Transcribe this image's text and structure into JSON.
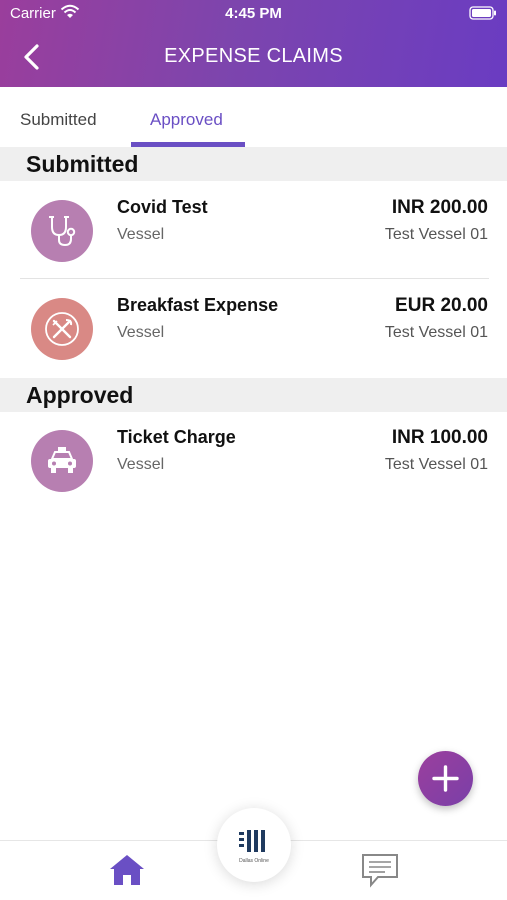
{
  "status_bar": {
    "carrier": "Carrier",
    "time": "4:45 PM"
  },
  "header": {
    "title": "EXPENSE CLAIMS"
  },
  "tabs": [
    {
      "label": "Submitted",
      "active": false
    },
    {
      "label": "Approved",
      "active": true
    }
  ],
  "sections": {
    "submitted": {
      "title": "Submitted",
      "items": [
        {
          "title": "Covid Test",
          "subtitle": "Vessel",
          "amount": "INR 200.00",
          "vessel": "Test Vessel 01",
          "icon": "stethoscope-icon",
          "color": "#b77fb1"
        },
        {
          "title": "Breakfast Expense",
          "subtitle": "Vessel",
          "amount": "EUR 20.00",
          "vessel": "Test Vessel 01",
          "icon": "cutlery-icon",
          "color": "#d98985"
        }
      ]
    },
    "approved": {
      "title": "Approved",
      "items": [
        {
          "title": "Ticket Charge",
          "subtitle": "Vessel",
          "amount": "INR 100.00",
          "vessel": "Test Vessel 01",
          "icon": "taxi-icon",
          "color": "#b77fb1"
        }
      ]
    }
  },
  "bottom_nav": {
    "center_logo_text": "Dallas Online"
  },
  "colors": {
    "accent": "#6a4fc4",
    "header_start": "#9a3e9c",
    "header_end": "#6a3cc2"
  }
}
